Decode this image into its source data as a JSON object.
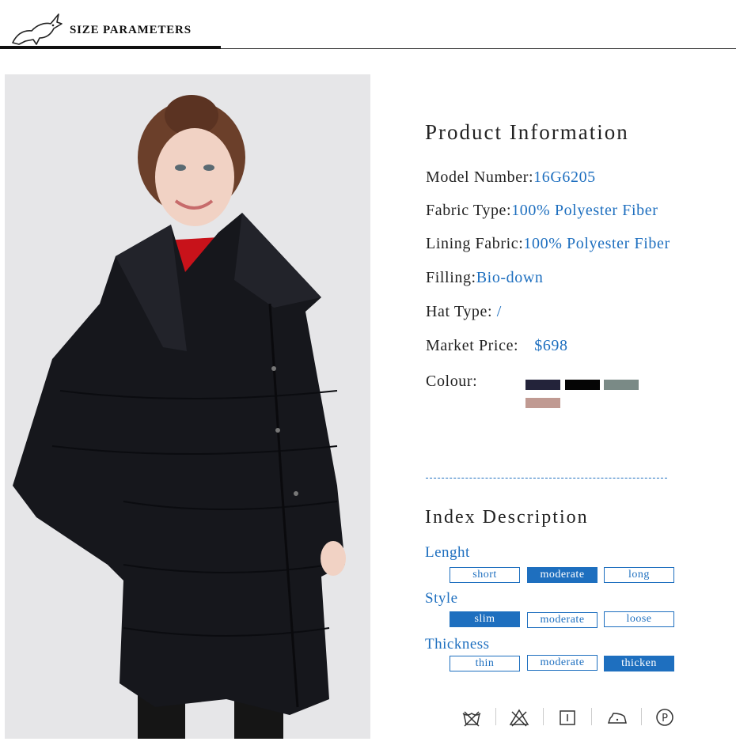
{
  "header": {
    "title": "SIZE PARAMETERS",
    "logo_icon": "rabbit-logo-icon"
  },
  "product": {
    "section_title": "Product Information",
    "model": {
      "label": "Model Number:",
      "value": "16G6205"
    },
    "fabric": {
      "label": "Fabric Type:",
      "value": "100% Polyester Fiber"
    },
    "lining": {
      "label": "Lining Fabric:",
      "value": "100% Polyester Fiber"
    },
    "filling": {
      "label": "Filling:",
      "value": "Bio-down"
    },
    "hat": {
      "label": "Hat Type: ",
      "value": "/"
    },
    "price": {
      "label": "Market Price:",
      "value": "$698"
    },
    "colour": {
      "label": "Colour:",
      "swatches": [
        "#23233a",
        "#050505",
        "#7a8a86",
        "#c09a92"
      ]
    }
  },
  "index": {
    "section_title": "Index Description",
    "length": {
      "label": "Lenght",
      "options": [
        "short",
        "moderate",
        "long"
      ],
      "selected": "moderate"
    },
    "style": {
      "label": "Style",
      "options": [
        "slim",
        "moderate",
        "loose"
      ],
      "selected": "slim"
    },
    "thickness": {
      "label": "Thickness",
      "options": [
        "thin",
        "moderate",
        "thicken"
      ],
      "selected": "thicken"
    }
  },
  "care_icons": [
    "no-hand-wash-icon",
    "no-bleach-icon",
    "tumble-dry-icon",
    "ironing-icon",
    "dry-clean-p-icon"
  ],
  "accent_color": "#1e6fbf"
}
